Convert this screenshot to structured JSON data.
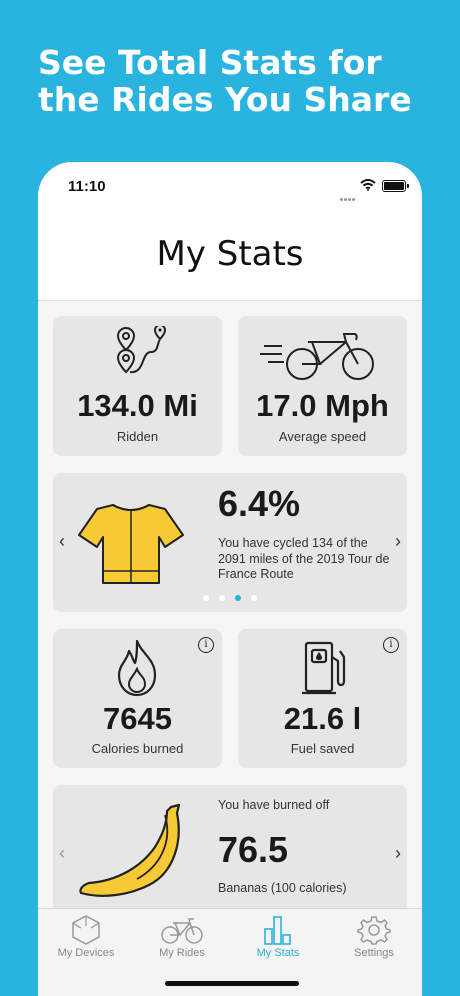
{
  "headline": "See Total Stats for the Rides You Share",
  "status_bar": {
    "time": "11:10"
  },
  "page_title": "My Stats",
  "cards": {
    "distance": {
      "value": "134.0 Mi",
      "label": "Ridden",
      "icon": "route-pin-icon"
    },
    "speed": {
      "value": "17.0 Mph",
      "label": "Average speed",
      "icon": "fast-bicycle-icon"
    },
    "tour": {
      "value": "6.4%",
      "description": "You have cycled 134 of the 2091 miles of the 2019 Tour de France Route",
      "icon": "cycling-jersey-icon",
      "pages": 4,
      "active_page": 3
    },
    "calories": {
      "value": "7645",
      "label": "Calories burned",
      "icon": "flame-icon"
    },
    "fuel": {
      "value": "21.6 l",
      "label": "Fuel saved",
      "icon": "fuel-pump-icon"
    },
    "bananas": {
      "intro": "You have burned off",
      "value": "76.5",
      "label": "Bananas (100 calories)",
      "icon": "banana-icon"
    }
  },
  "tabs": [
    {
      "label": "My Devices",
      "icon": "hexagon-device-icon",
      "active": false
    },
    {
      "label": "My Rides",
      "icon": "bicycle-icon",
      "active": false
    },
    {
      "label": "My Stats",
      "icon": "bar-chart-icon",
      "active": true
    },
    {
      "label": "Settings",
      "icon": "gear-icon",
      "active": false
    }
  ],
  "colors": {
    "accent": "#29b3df",
    "jersey": "#f7c934",
    "banana": "#f7c934",
    "card": "#e6e6e6"
  }
}
